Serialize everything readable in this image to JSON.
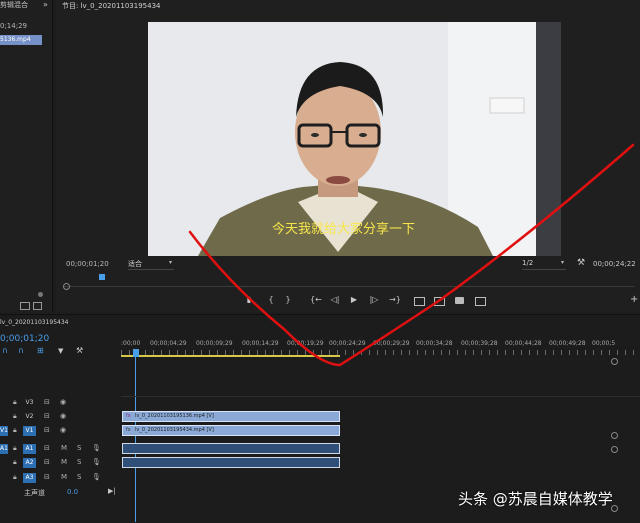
{
  "left_panel": {
    "title": "剪辑混合",
    "expand": "»",
    "timecode": "0;14;29",
    "selected_item": "5136.mp4"
  },
  "program": {
    "title": "节目: lv_0_20201103195434",
    "subtitle": "今天我就给大家分享一下",
    "current_timecode": "00;00;01;20",
    "fit_label": "适合",
    "resolution": "1/2",
    "duration": "00;00;24;22"
  },
  "controls": [
    "{",
    "}",
    "{←",
    "◁|",
    "▶",
    "|▷",
    "→}"
  ],
  "timeline": {
    "sequence_name": "lv_0_20201103195434",
    "timecode": "0;00;01;20",
    "ruler_labels": [
      ":00;00",
      "00;00;04;29",
      "00;00;09;29",
      "00;00;14;29",
      "00;00;19;29",
      "00;00;24;29",
      "00;00;29;29",
      "00;00;34;28",
      "00;00;39;28",
      "00;00;44;28",
      "00;00;49;28",
      "00;00;5"
    ],
    "tracks": [
      {
        "name": "V3",
        "target": ""
      },
      {
        "name": "V2",
        "target": ""
      },
      {
        "name": "V1",
        "target": "V1"
      },
      {
        "name": "A1",
        "target": "A1"
      },
      {
        "name": "A2",
        "target": ""
      },
      {
        "name": "A3",
        "target": ""
      }
    ],
    "mix": {
      "label": "主声道",
      "value": "0.0"
    },
    "clips": {
      "v2": "lv_0_20201103195136.mp4 [V]",
      "v1": "lv_0_20201103195434.mp4 [V]"
    }
  },
  "watermark": "头条 @苏晨自媒体教学",
  "colors": {
    "accent": "#4a9ee8",
    "annotation": "#e01010"
  }
}
